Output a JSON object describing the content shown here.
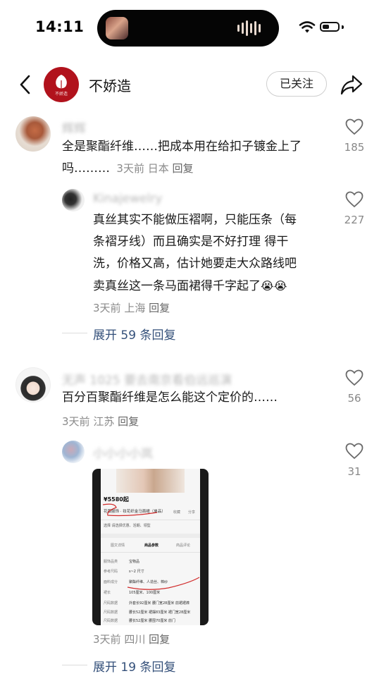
{
  "status": {
    "time": "14:11"
  },
  "header": {
    "author": "不娇造",
    "logo_text": "不娇造",
    "follow": "已关注"
  },
  "comments": [
    {
      "name": "辉辉",
      "text": "全是聚酯纤维……把成本用在给扣子镀金上了",
      "text2": "吗………",
      "time": "3天前",
      "loc": "日本",
      "reply": "回复",
      "likes": "185"
    },
    {
      "name": "Kinajewelry",
      "text": "真丝其实不能做压褶啊，只能压条（每",
      "text2": "条褶牙线）而且确实是不好打理 得干",
      "text3": "洗，价格又高，估计她要走大众路线吧",
      "text4": "卖真丝这一条马面裙得千字起了",
      "time": "3天前",
      "loc": "上海",
      "reply": "回复",
      "likes": "227"
    },
    {
      "expand": "展开 59 条回复"
    },
    {
      "name": "无声 1025 要去南京看伯远巡演",
      "text": "百分百聚酯纤维是怎么能这个定价的……",
      "time": "3天前",
      "loc": "江苏",
      "reply": "回复",
      "likes": "56"
    },
    {
      "name": "小小小小岚",
      "time": "3天前",
      "loc": "四川",
      "reply": "回复",
      "likes": "31"
    },
    {
      "expand": "展开 19 条回复"
    }
  ],
  "shot": {
    "price": "¥5580起",
    "title": "花版服饰 · 妆花织金马面裙（单品）",
    "fav": "收藏",
    "share": "分享",
    "select": "选择 请选择优惠、活期、领型",
    "tabs": [
      "图文详情",
      "商品参数",
      "商品评论"
    ],
    "rows": [
      {
        "k": "服饰品类",
        "v": "宝物品"
      },
      {
        "k": "参考尺码",
        "v": "s~2 尺寸"
      },
      {
        "k": "面料成分",
        "v": "聚酯纤维、人造丝、棉纱"
      },
      {
        "k": "裙长",
        "v": "105厘米、100厘米"
      },
      {
        "k": "尺码数据",
        "v": "外套长92厘米 腰门宽28厘米 前裙裙襟"
      },
      {
        "k": "尺码数据",
        "v": "腰长52厘米 裙摆83厘米 裙门宽28厘米"
      },
      {
        "k": "尺码数据",
        "v": "腰长52厘米 腰围70厘米 前门"
      }
    ]
  },
  "colors": {
    "brand": "#b1121c",
    "link": "#34507a",
    "like": "#6a6a6a"
  }
}
